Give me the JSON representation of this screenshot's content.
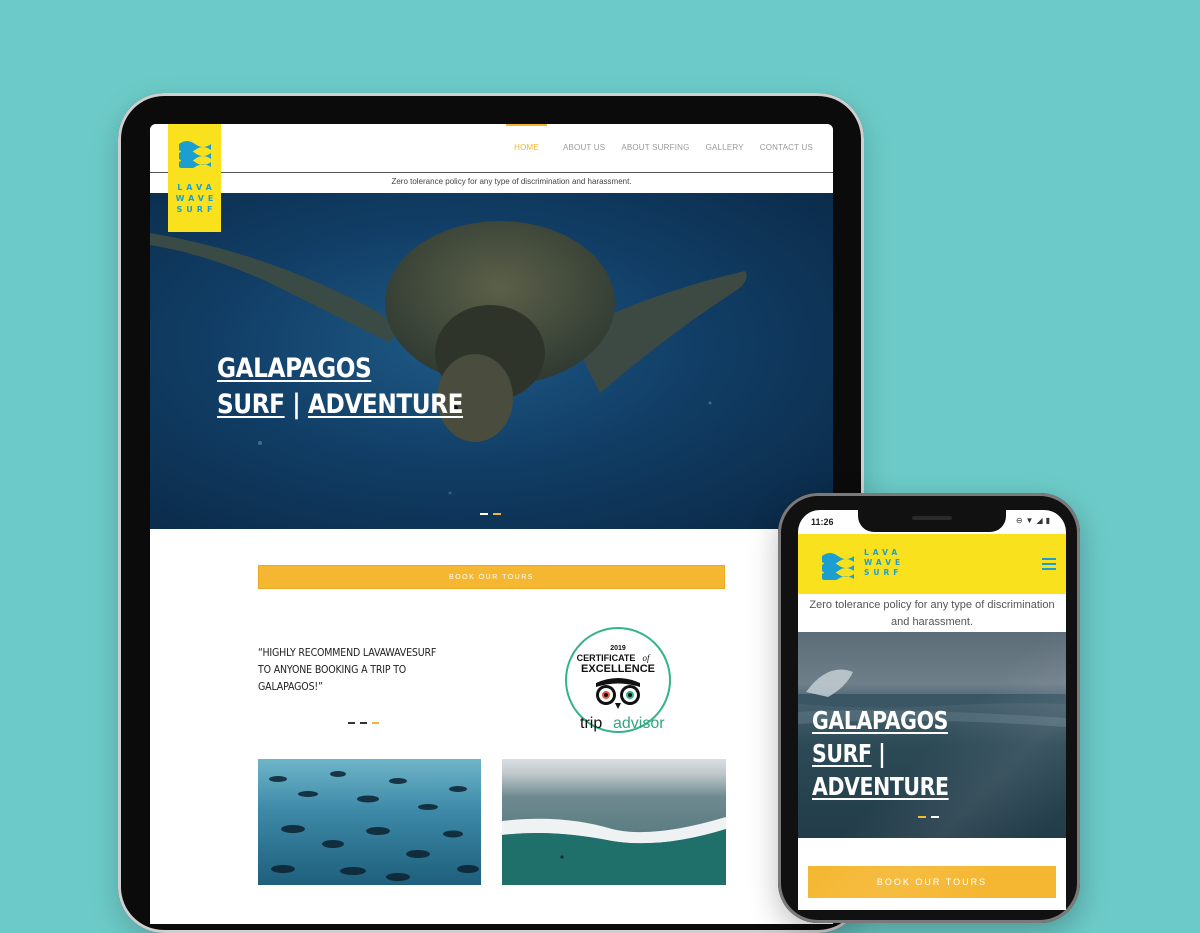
{
  "brand": {
    "logo_lines": [
      "LAVA",
      "WAVE",
      "SURF"
    ],
    "colors": {
      "background": "#6ccbc8",
      "yellow": "#f9e21d",
      "accent": "#f2b632",
      "logo_blue": "#1a9fd0"
    }
  },
  "tablet": {
    "nav": [
      {
        "label": "HOME",
        "active": true
      },
      {
        "label": "ABOUT US",
        "active": false
      },
      {
        "label": "ABOUT SURFING",
        "active": false
      },
      {
        "label": "GALLERY",
        "active": false
      },
      {
        "label": "CONTACT US",
        "active": false
      }
    ],
    "notice": "Zero tolerance policy for any type of discrimination and harassment.",
    "hero": {
      "line1": "GALAPAGOS",
      "line2a": "SURF",
      "separator": "|",
      "line2b": "ADVENTURE",
      "image": "sea-turtle-underwater"
    },
    "book_button": "BOOK OUR TOURS",
    "testimonial": "“HIGHLY RECOMMEND LAVAWAVESURF TO ANYONE BOOKING A TRIP TO GALAPAGOS!”",
    "badge": {
      "year": "2019",
      "line1": "CERTIFICATE",
      "of": "of",
      "line2": "EXCELLENCE",
      "brand_a": "trip",
      "brand_b": "advisor"
    },
    "thumbnails": [
      {
        "image": "school-of-fish"
      },
      {
        "image": "aerial-wave"
      }
    ]
  },
  "phone": {
    "status": {
      "time": "11:26"
    },
    "notice": "Zero tolerance policy for any type of discrimination and harassment.",
    "hero": {
      "line1": "GALAPAGOS",
      "line2a": "SURF",
      "separator": "|",
      "line2b": "ADVENTURE",
      "image": "surfer-on-wave"
    },
    "book_button": "BOOK OUR TOURS",
    "menu_icon": "hamburger-icon"
  }
}
